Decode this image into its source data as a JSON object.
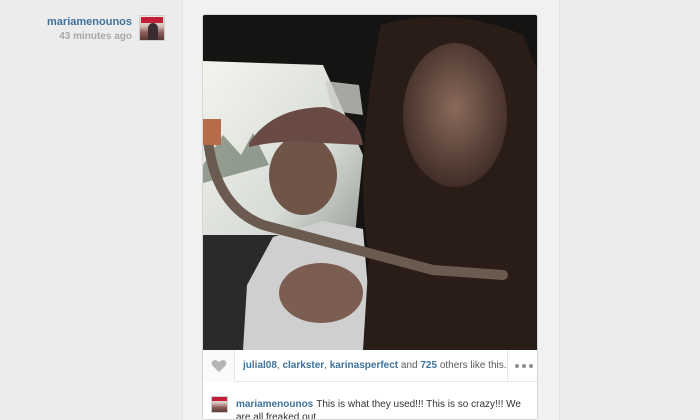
{
  "post": {
    "author": {
      "username": "mariamenounos",
      "time_ago": "43 minutes ago"
    },
    "likes": {
      "users": [
        "julial08",
        "clarkster",
        "karinasperfect"
      ],
      "separator": ", ",
      "conjunction": " and ",
      "others_count": "725",
      "others_suffix": " others like this."
    },
    "caption": {
      "username": "mariamenounos",
      "text": "This is what they used!!! This is so crazy!!! We are all freaked out"
    }
  },
  "colors": {
    "link": "#3f729b",
    "muted": "#a8a8a8",
    "page_bg": "#eaeaea"
  },
  "icons": {
    "like": "heart-icon",
    "more": "ellipsis-icon"
  }
}
